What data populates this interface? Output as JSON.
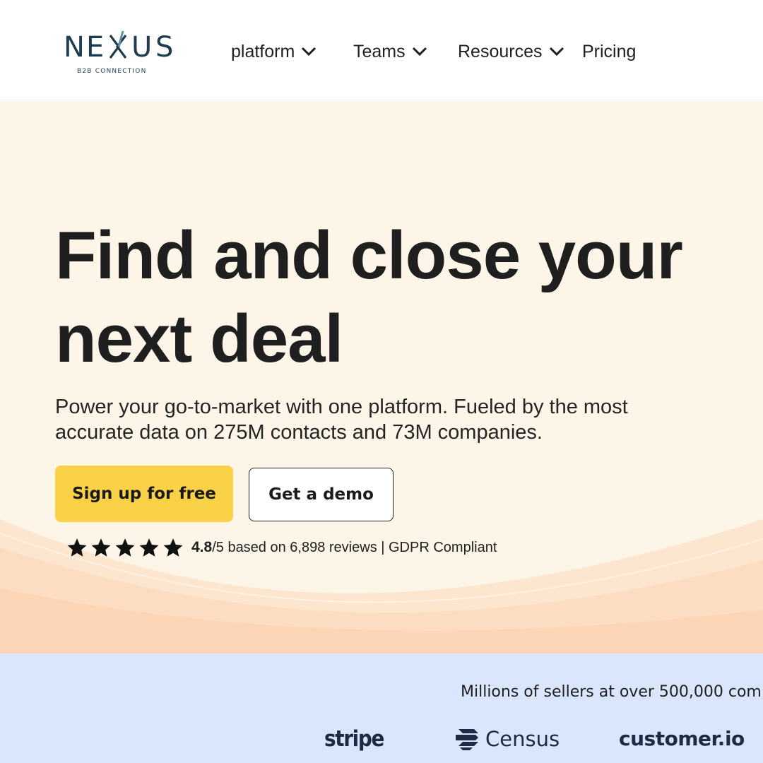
{
  "brand": {
    "name": "NEXUS",
    "tagline": "B2B CONNECTION",
    "colors": {
      "dark": "#1f3b4d",
      "accent": "#5b8fa8"
    }
  },
  "nav": {
    "items": [
      {
        "label": "platform",
        "has_dropdown": true
      },
      {
        "label": "Teams",
        "has_dropdown": true
      },
      {
        "label": "Resources",
        "has_dropdown": true
      },
      {
        "label": "Pricing",
        "has_dropdown": false
      }
    ]
  },
  "hero": {
    "headline_line1": "Find and close your",
    "headline_line2": "next deal",
    "subheadline_line1": "Power your go-to-market with one platform. Fueled by the most",
    "subheadline_line2": "accurate data on 275M contacts and 73M companies.",
    "primary_cta": "Sign up for free",
    "secondary_cta": "Get a demo",
    "rating": {
      "stars": 5,
      "value": "4.8",
      "suffix": "/5 based on 6,898 reviews | GDPR Compliant"
    }
  },
  "trust": {
    "text": "Millions of sellers at over 500,000 com",
    "logos": [
      "stripe",
      "Census",
      "customer.io"
    ]
  },
  "colors": {
    "hero_bg": "#fdf5e8",
    "cta_yellow": "#f9d248",
    "trust_bg": "#dae6fc"
  }
}
